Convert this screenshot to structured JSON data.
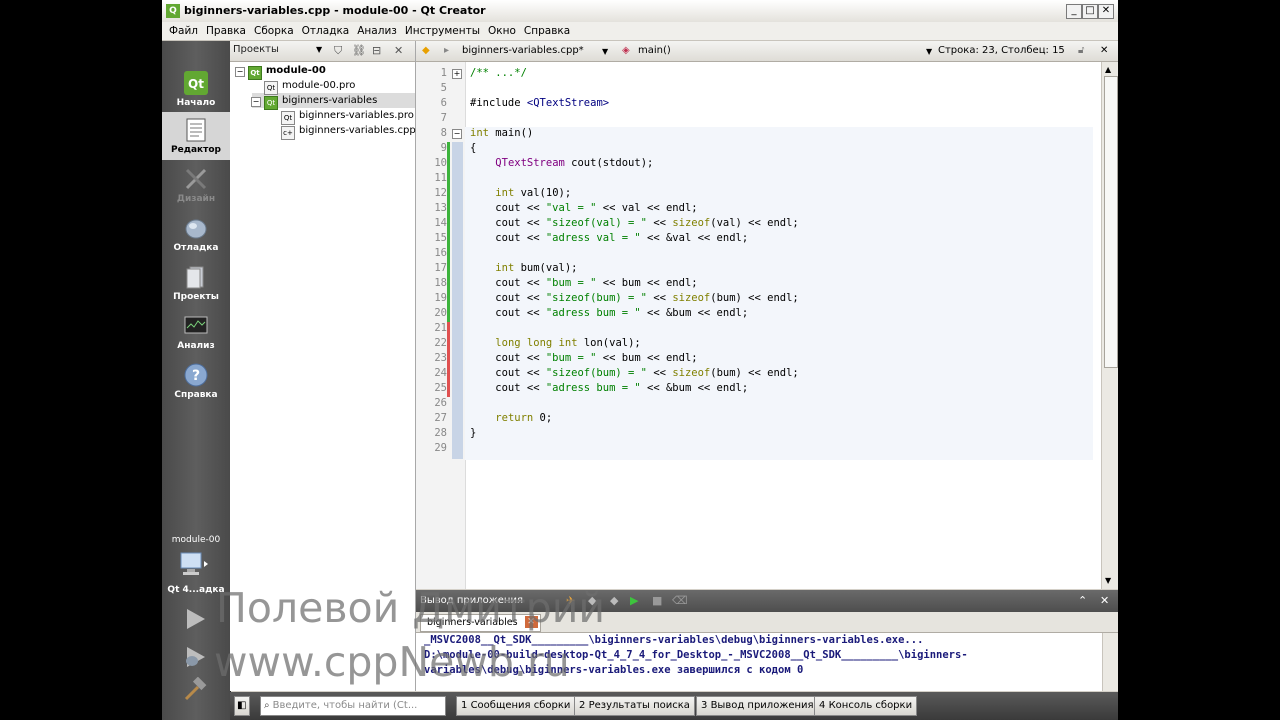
{
  "window": {
    "title": "biginners-variables.cpp - module-00 - Qt Creator"
  },
  "menu": [
    "Файл",
    "Правка",
    "Сборка",
    "Отладка",
    "Анализ",
    "Инструменты",
    "Окно",
    "Справка"
  ],
  "modes": [
    {
      "label": "Начало"
    },
    {
      "label": "Редактор"
    },
    {
      "label": "Дизайн"
    },
    {
      "label": "Отладка"
    },
    {
      "label": "Проекты"
    },
    {
      "label": "Анализ"
    },
    {
      "label": "Справка"
    }
  ],
  "target": {
    "project": "module-00",
    "kit": "Qt 4...адка"
  },
  "project_panel": {
    "selector": "Проекты",
    "tree": [
      "module-00",
      "module-00.pro",
      "biginners-variables",
      "biginners-variables.pro",
      "biginners-variables.cpp"
    ]
  },
  "editor_toolbar": {
    "file": "biginners-variables.cpp*",
    "symbol": "main()",
    "position": "Строка: 23, Столбец: 15"
  },
  "code": {
    "lines": [
      {
        "n": "1",
        "t": "/** ...*/"
      },
      {
        "n": "5",
        "t": ""
      },
      {
        "n": "6",
        "t": "#include <QTextStream>"
      },
      {
        "n": "7",
        "t": ""
      },
      {
        "n": "8",
        "t": "int main()"
      },
      {
        "n": "9",
        "t": "{"
      },
      {
        "n": "10",
        "t": "    QTextStream cout(stdout);"
      },
      {
        "n": "11",
        "t": ""
      },
      {
        "n": "12",
        "t": "    int val(10);"
      },
      {
        "n": "13",
        "t": "    cout << \"val = \" << val << endl;"
      },
      {
        "n": "14",
        "t": "    cout << \"sizeof(val) = \" << sizeof(val) << endl;"
      },
      {
        "n": "15",
        "t": "    cout << \"adress val = \" << &val << endl;"
      },
      {
        "n": "16",
        "t": ""
      },
      {
        "n": "17",
        "t": "    int bum(val);"
      },
      {
        "n": "18",
        "t": "    cout << \"bum = \" << bum << endl;"
      },
      {
        "n": "19",
        "t": "    cout << \"sizeof(bum) = \" << sizeof(bum) << endl;"
      },
      {
        "n": "20",
        "t": "    cout << \"adress bum = \" << &bum << endl;"
      },
      {
        "n": "21",
        "t": ""
      },
      {
        "n": "22",
        "t": "    long long int lon(val);"
      },
      {
        "n": "23",
        "t": "    cout << \"bum = \" << bum << endl;"
      },
      {
        "n": "24",
        "t": "    cout << \"sizeof(bum) = \" << sizeof(bum) << endl;"
      },
      {
        "n": "25",
        "t": "    cout << \"adress bum = \" << &bum << endl;"
      },
      {
        "n": "26",
        "t": ""
      },
      {
        "n": "27",
        "t": "    return 0;"
      },
      {
        "n": "28",
        "t": "}"
      },
      {
        "n": "29",
        "t": ""
      }
    ]
  },
  "output": {
    "title": "Вывод приложения",
    "tab": "biginners-variables",
    "lines": [
      "_MSVC2008__Qt_SDK_________\\biginners-variables\\debug\\biginners-variables.exe...",
      "D:\\module-00-build-desktop-Qt_4_7_4_for_Desktop_-_MSVC2008__Qt_SDK_________\\biginners-",
      "variables\\debug\\biginners-variables.exe завершился с кодом 0"
    ]
  },
  "statusbar": {
    "search_placeholder": "Введите, чтобы найти (Ct...",
    "panes": [
      {
        "num": "1",
        "label": "Сообщения сборки"
      },
      {
        "num": "2",
        "label": "Результаты поиска"
      },
      {
        "num": "3",
        "label": "Вывод приложения"
      },
      {
        "num": "4",
        "label": "Консоль сборки"
      }
    ]
  },
  "watermark": {
    "line1": "Полевой Дмитрий",
    "line2": "www.cppNewb.ru"
  },
  "colors": {
    "keyword": "#808000",
    "string": "#008000",
    "type": "#800080",
    "qt_green": "#62a832"
  }
}
